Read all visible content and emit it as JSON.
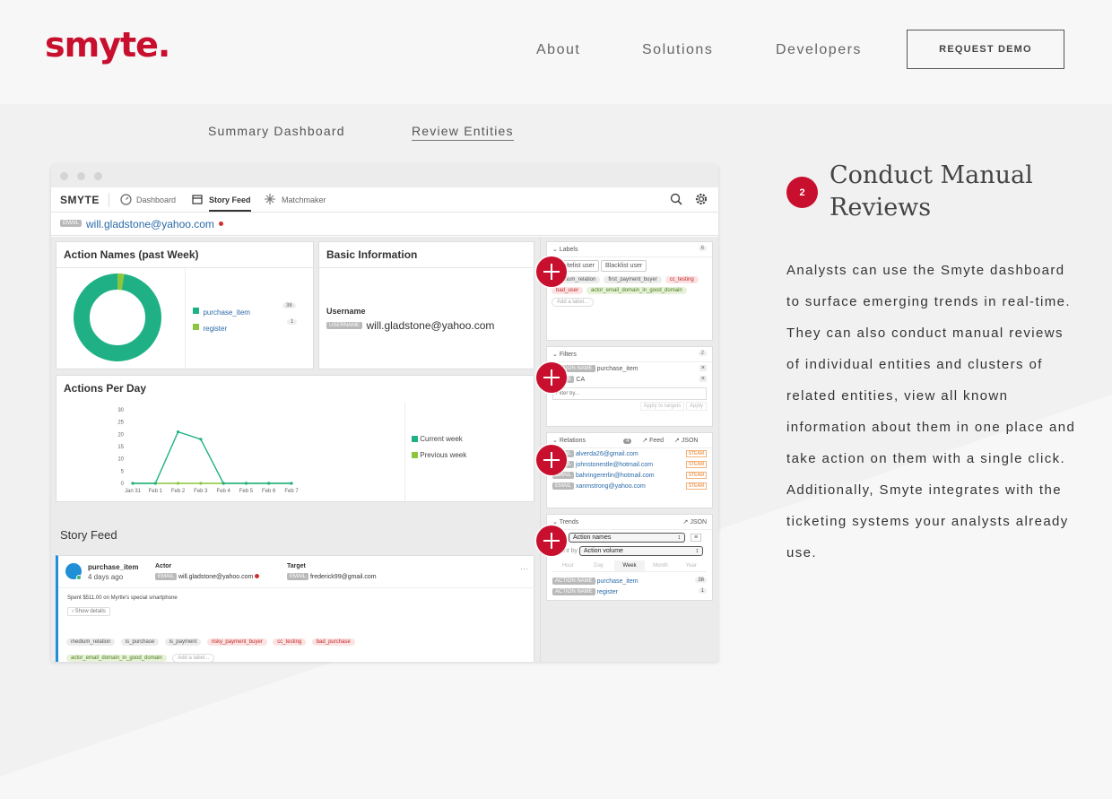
{
  "brand": {
    "logo": "smyte."
  },
  "nav": {
    "items": [
      "About",
      "Solutions",
      "Developers"
    ],
    "cta": "REQUEST DEMO"
  },
  "tabs": [
    "Summary Dashboard",
    "Review Entities"
  ],
  "app": {
    "brand": "SMYTE",
    "nav": [
      "Dashboard",
      "Story Feed",
      "Matchmaker"
    ],
    "entity_tag": "EMAIL",
    "entity": "will.gladstone@yahoo.com",
    "action_names": {
      "title": "Action Names (past Week)",
      "items": [
        {
          "label": "purchase_item",
          "count": "38",
          "color": "#1fb185"
        },
        {
          "label": "register",
          "count": "1",
          "color": "#8cc63f"
        }
      ]
    },
    "basic_info": {
      "title": "Basic Information",
      "field": "Username",
      "tag": "USERNAME",
      "value": "will.gladstone@yahoo.com"
    },
    "actions_per_day": {
      "title": "Actions Per Day",
      "legend": [
        "Current week",
        "Previous week"
      ]
    },
    "story_feed": {
      "title": "Story Feed",
      "event": "purchase_item",
      "time": "4 days ago",
      "actor_label": "Actor",
      "actor_tag": "EMAIL",
      "actor": "will.gladstone@yahoo.com",
      "target_label": "Target",
      "target_tag": "EMAIL",
      "target": "frederick99@gmail.com",
      "desc": "Spent $511.00 on Myrtle's special smartphone",
      "details": "Show details",
      "labels": [
        "medium_relation",
        "is_purchase",
        "is_payment",
        "risky_payment_buyer",
        "cc_testing",
        "bad_purchase",
        "actor_email_domain_in_good_domain"
      ],
      "add_label": "Add a label..."
    },
    "labels_panel": {
      "title": "Labels",
      "count": "6",
      "buttons": [
        "Whitelist user",
        "Blacklist user"
      ],
      "pills": [
        "medium_relation",
        "first_payment_buyer",
        "cc_testing",
        "bad_user",
        "actor_email_domain_in_good_domain"
      ],
      "add": "Add a label..."
    },
    "filters_panel": {
      "title": "Filters",
      "count": "2",
      "rows": [
        {
          "tag": "ACTION NAME",
          "value": "purchase_item"
        },
        {
          "tag": "STATE",
          "value": "CA"
        }
      ],
      "placeholder": "Filter by...",
      "btn1": "Apply to targets",
      "btn2": "Apply"
    },
    "relations_panel": {
      "title": "Relations",
      "count": "4",
      "feed": "Feed",
      "json": "JSON",
      "rows": [
        {
          "tag": "EMAIL",
          "value": "alverda26@gmail.com"
        },
        {
          "tag": "EMAIL",
          "value": "johnstonestle@hotmail.com"
        },
        {
          "tag": "EMAIL",
          "value": "bahringererlin@hotmail.com"
        },
        {
          "tag": "EMAIL",
          "value": "xanmstrong@yahoo.com"
        }
      ],
      "status": "STEAM"
    },
    "trends_panel": {
      "title": "Trends",
      "json": "JSON",
      "select1": "Action names",
      "count_by": "Count by",
      "select2": "Action volume",
      "periods": [
        "Hour",
        "Day",
        "Week",
        "Month",
        "Year"
      ],
      "rows": [
        {
          "tag": "ACTION NAME",
          "value": "purchase_item",
          "count": "38"
        },
        {
          "tag": "ACTION NAME",
          "value": "register",
          "count": "1"
        }
      ]
    }
  },
  "feature": {
    "step": "2",
    "title": "Conduct Manual Reviews",
    "description": "Analysts can use the Smyte dashboard to surface emerging trends in real-time. They can also conduct manual reviews of individual entities and clusters of related entities, view all known information about them in one place and take action on them with a single click. Additionally, Smyte integrates with the ticketing systems your analysts already use."
  },
  "chart_data": {
    "type": "line",
    "categories": [
      "Jan 31",
      "Feb 1",
      "Feb 2",
      "Feb 3",
      "Feb 4",
      "Feb 5",
      "Feb 6",
      "Feb 7"
    ],
    "series": [
      {
        "name": "Current week",
        "values": [
          0,
          0,
          21,
          18,
          0,
          0,
          0,
          0
        ],
        "color": "#1fb185"
      },
      {
        "name": "Previous week",
        "values": [
          0,
          0,
          0,
          0,
          0,
          0,
          0,
          0
        ],
        "color": "#8cc63f"
      }
    ],
    "yticks": [
      0,
      5,
      10,
      15,
      20,
      25,
      30
    ],
    "ylim": [
      0,
      30
    ]
  }
}
